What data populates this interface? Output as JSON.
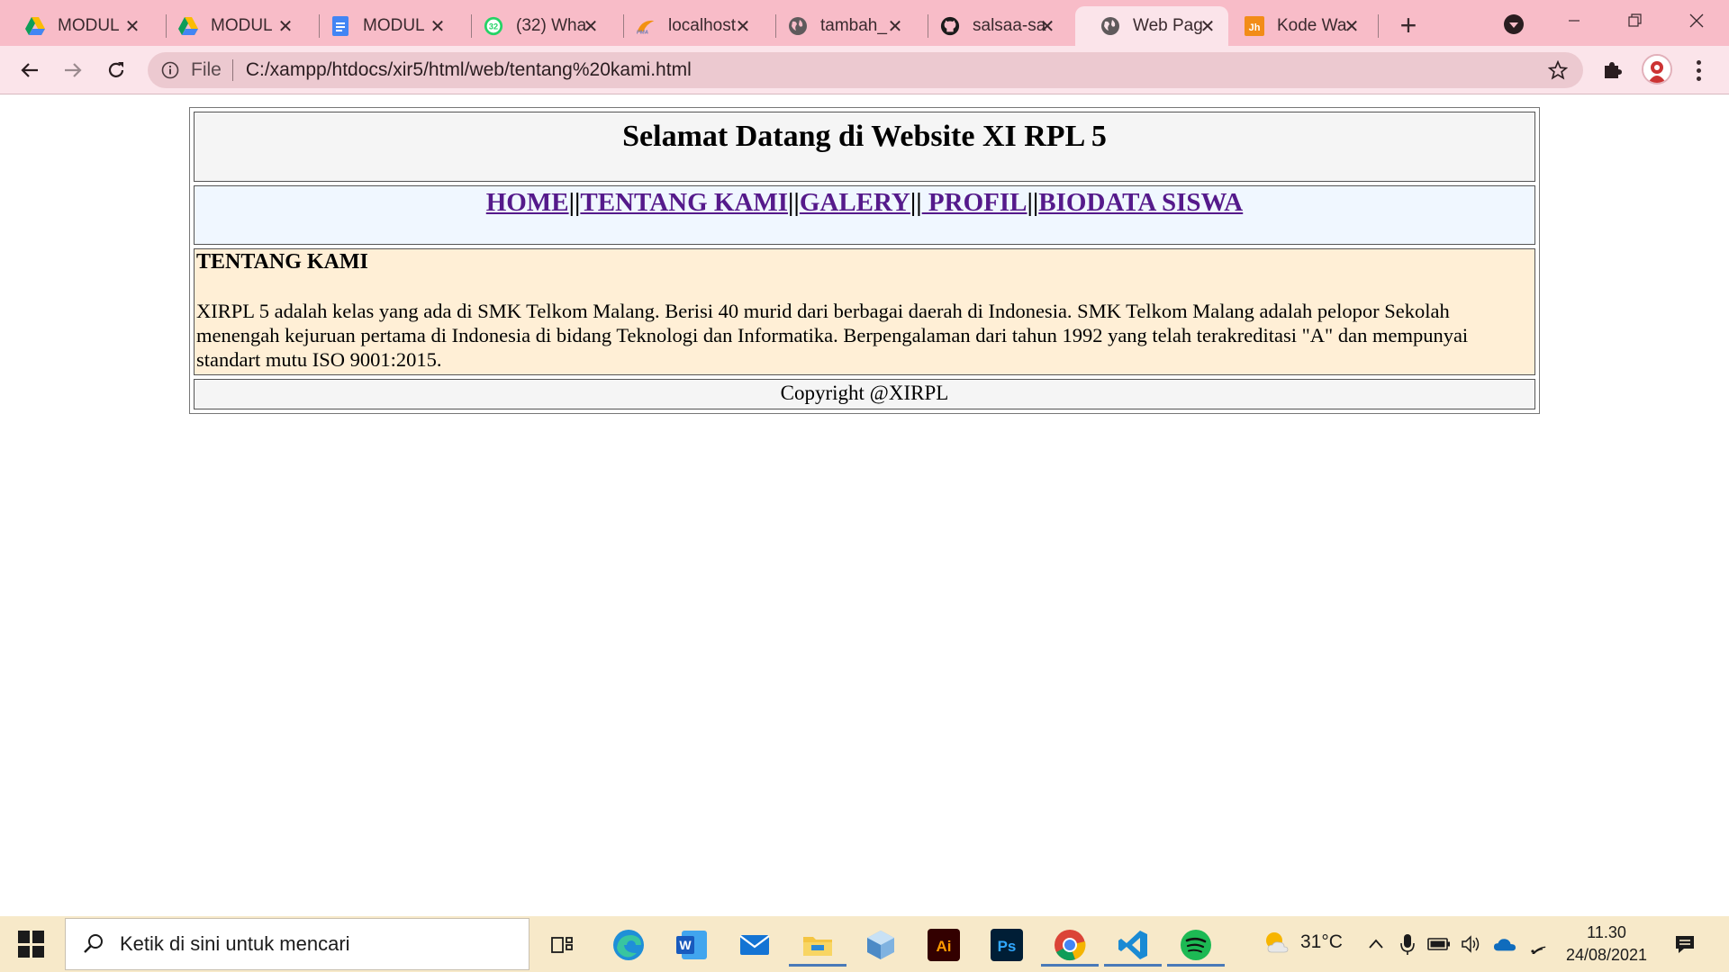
{
  "browser": {
    "tabs": [
      {
        "title": "MODUL",
        "icon": "google-drive-icon",
        "active": false
      },
      {
        "title": "MODUL",
        "icon": "google-drive-icon",
        "active": false
      },
      {
        "title": "MODUL",
        "icon": "google-docs-icon",
        "active": false
      },
      {
        "title": "(32) Wha",
        "icon": "whatsapp-icon",
        "badge": "32",
        "active": false
      },
      {
        "title": "localhost",
        "icon": "phpmyadmin-icon",
        "active": false
      },
      {
        "title": "tambah_",
        "icon": "globe-icon",
        "active": false
      },
      {
        "title": "salsaa-sa",
        "icon": "github-icon",
        "active": false
      },
      {
        "title": "Web Pag",
        "icon": "globe-icon",
        "active": true
      },
      {
        "title": "Kode Wa",
        "icon": "html-code-icon",
        "active": false
      }
    ],
    "new_tab_label": "+",
    "address": {
      "scheme": "File",
      "url": "C:/xampp/htdocs/xir5/html/web/tentang%20kami.html"
    },
    "colors": {
      "tabstrip": "#f8bcc8",
      "toolbar": "#fbe4ea",
      "omnibox": "#ecc9d0"
    }
  },
  "page": {
    "header_title": "Selamat Datang di Website XI RPL 5",
    "nav": {
      "links": [
        "HOME",
        "TENTANG KAMI",
        "GALERY",
        " PROFIL",
        "BIODATA SISWA"
      ],
      "separator": "||"
    },
    "content": {
      "heading": "TENTANG KAMI",
      "body": "XIRPL 5 adalah kelas yang ada di SMK Telkom Malang. Berisi 40 murid dari berbagai daerah di Indonesia. SMK Telkom Malang adalah pelopor Sekolah menengah kejuruan pertama di Indonesia di bidang Teknologi dan Informatika. Berpengalaman dari tahun 1992 yang telah terakreditasi \"A\" dan mempunyai standart mutu ISO 9001:2015."
    },
    "footer": "Copyright @XIRPL",
    "colors": {
      "header_bg": "#f5f5f5",
      "nav_bg": "#f0f7ff",
      "content_bg": "#ffefd6",
      "link": "#551a8b"
    }
  },
  "taskbar": {
    "search_placeholder": "Ketik di sini untuk mencari",
    "apps": [
      "task-view-icon",
      "edge-icon",
      "word-icon",
      "mail-icon",
      "file-explorer-icon",
      "3d-viewer-icon",
      "illustrator-icon",
      "photoshop-icon",
      "chrome-icon",
      "vscode-icon",
      "spotify-icon"
    ],
    "weather_temp": "31°C",
    "time": "11.30",
    "date": "24/08/2021",
    "app_labels": {
      "illustrator": "Ai",
      "photoshop": "Ps",
      "word": "W"
    }
  }
}
